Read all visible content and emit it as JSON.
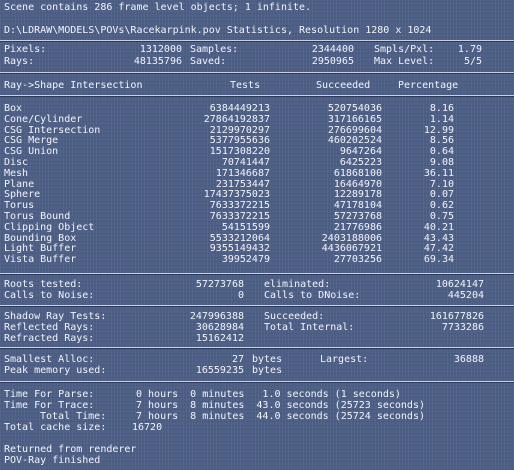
{
  "header": {
    "scene_line": "Scene contains 286 frame level objects; 1 infinite.",
    "stats_line": "D:\\LDRAW\\MODELS\\POVs\\Racekarpink.pov Statistics, Resolution 1280 x 1024"
  },
  "render": [
    {
      "label": "Pixels:",
      "value": "1312000",
      "label2": "Samples:",
      "value2": "2344400",
      "label3": "Smpls/Pxl:",
      "value3": "1.79"
    },
    {
      "label": "Rays:",
      "value": "48135796",
      "label2": "Saved:",
      "value2": "2950965",
      "label3": "Max Level:",
      "value3": "5/5"
    }
  ],
  "intersection": {
    "headers": [
      "Ray->Shape Intersection",
      "Tests",
      "Succeeded",
      "Percentage"
    ],
    "rows": [
      {
        "name": "Box",
        "tests": "6384449213",
        "succeeded": "520754036",
        "pct": "8.16"
      },
      {
        "name": "Cone/Cylinder",
        "tests": "27864192837",
        "succeeded": "317166165",
        "pct": "1.14"
      },
      {
        "name": "CSG Intersection",
        "tests": "2129970297",
        "succeeded": "276699604",
        "pct": "12.99"
      },
      {
        "name": "CSG Merge",
        "tests": "5377955636",
        "succeeded": "460202524",
        "pct": "8.56"
      },
      {
        "name": "CSG Union",
        "tests": "1517308220",
        "succeeded": "9647264",
        "pct": "0.64"
      },
      {
        "name": "Disc",
        "tests": "70741447",
        "succeeded": "6425223",
        "pct": "9.08"
      },
      {
        "name": "Mesh",
        "tests": "171346687",
        "succeeded": "61868100",
        "pct": "36.11"
      },
      {
        "name": "Plane",
        "tests": "231753447",
        "succeeded": "16464970",
        "pct": "7.10"
      },
      {
        "name": "Sphere",
        "tests": "17437375023",
        "succeeded": "12289178",
        "pct": "0.07"
      },
      {
        "name": "Torus",
        "tests": "7633372215",
        "succeeded": "47178104",
        "pct": "0.62"
      },
      {
        "name": "Torus Bound",
        "tests": "7633372215",
        "succeeded": "57273768",
        "pct": "0.75"
      },
      {
        "name": "Clipping Object",
        "tests": "54151599",
        "succeeded": "21776986",
        "pct": "40.21"
      },
      {
        "name": "Bounding Box",
        "tests": "5533212064",
        "succeeded": "2403188006",
        "pct": "43.43"
      },
      {
        "name": "Light Buffer",
        "tests": "9355149432",
        "succeeded": "4436067921",
        "pct": "47.42"
      },
      {
        "name": "Vista Buffer",
        "tests": "39952479",
        "succeeded": "27703256",
        "pct": "69.34"
      }
    ]
  },
  "roots": [
    {
      "label": "Roots tested:",
      "value": "57273768",
      "label2": "eliminated:",
      "value2": "10624147"
    },
    {
      "label": "Calls to Noise:",
      "value": "0",
      "label2": "Calls to DNoise:",
      "value2": "445204"
    }
  ],
  "shadow": [
    {
      "label": "Shadow Ray Tests:",
      "value": "247996388",
      "label2": "Succeeded:",
      "value2": "161677826"
    },
    {
      "label": "Reflected Rays:",
      "value": "30628984",
      "label2": "Total Internal:",
      "value2": "7733286"
    },
    {
      "label": "Refracted Rays:",
      "value": "15162412",
      "label2": "",
      "value2": ""
    }
  ],
  "memory": {
    "smallest_label": "Smallest Alloc:",
    "smallest_value": "27",
    "smallest_unit": "bytes",
    "largest_label": "Largest:",
    "largest_value": "36888",
    "peak_label": "Peak memory used:",
    "peak_value": "16559235",
    "peak_unit": "bytes"
  },
  "timing": [
    {
      "label": "Time For Parse:",
      "text": "0 hours  0 minutes   1.0 seconds (1 seconds)"
    },
    {
      "label": "Time For Trace:",
      "text": "7 hours  8 minutes  43.0 seconds (25723 seconds)"
    },
    {
      "label": "Total Time:",
      "text": "7 hours  8 minutes  44.0 seconds (25724 seconds)"
    }
  ],
  "cache": {
    "label": "Total cache size:",
    "value": "16720"
  },
  "footer": {
    "returned": "Returned from renderer",
    "finished": "POV-Ray finished"
  },
  "colors": {
    "background": "#4e5f86",
    "text": "#f2f4fa",
    "rule_light": "#c9cfe0",
    "rule_dark": "#2d3a5a"
  }
}
